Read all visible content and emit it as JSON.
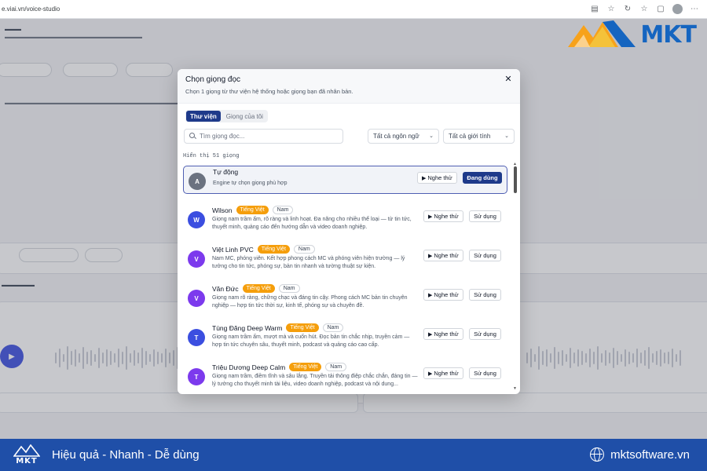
{
  "browser": {
    "url": "e.viai.vn/voice-studio"
  },
  "logo": {
    "text": "MKT"
  },
  "modal": {
    "title": "Chọn giọng đọc",
    "subtitle": "Chọn 1 giọng từ thư viện hệ thống hoặc giọng bạn đã nhân bản.",
    "tabs": [
      {
        "label": "Thư viện",
        "active": true
      },
      {
        "label": "Giọng của tôi",
        "active": false
      }
    ],
    "search_placeholder": "Tìm giọng đọc...",
    "language_filter": "Tất cả ngôn ngữ",
    "gender_filter": "Tất cả giới tính",
    "count_text": "Hiển thị 51 giọng",
    "voices": [
      {
        "initial": "A",
        "name": "Tự động",
        "desc": "Engine tự chọn giọng phù hợp",
        "listen": "Nghe thử",
        "action": "Đang dùng",
        "avatar_color": "#6b7280"
      },
      {
        "initial": "W",
        "name": "Wilson",
        "lang": "Tiếng Việt",
        "gender": "Nam",
        "desc": "Giọng nam trầm ấm, rõ ràng và linh hoạt. Đa năng cho nhiều thể loại — từ tin tức, thuyết minh, quảng cáo đến hướng dẫn và video doanh nghiệp.",
        "listen": "Nghe thử",
        "action": "Sử dụng",
        "avatar_color": "#3b4ee0"
      },
      {
        "initial": "V",
        "name": "Việt Linh PVC",
        "lang": "Tiếng Việt",
        "gender": "Nam",
        "desc": "Nam MC, phóng viên. Kết hợp phong cách MC và phóng viên hiện trường — lý tưởng cho tin tức, phóng sự, bản tin nhanh và tường thuật sự kiện.",
        "listen": "Nghe thử",
        "action": "Sử dụng",
        "avatar_color": "#7c3aed"
      },
      {
        "initial": "V",
        "name": "Văn Đức",
        "lang": "Tiếng Việt",
        "gender": "Nam",
        "desc": "Giọng nam rõ ràng, chững chạc và đáng tin cậy. Phong cách MC bản tin chuyên nghiệp — hợp tin tức thời sự, kinh tế, phóng sự và chuyên đề.",
        "listen": "Nghe thử",
        "action": "Sử dụng",
        "avatar_color": "#7c3aed"
      },
      {
        "initial": "T",
        "name": "Tùng Đăng Deep Warm",
        "lang": "Tiếng Việt",
        "gender": "Nam",
        "desc": "Giọng nam trầm ấm, mượt mà và cuốn hút. Đọc bản tin chắc nhịp, truyền cảm — hợp tin tức chuyên sâu, thuyết minh, podcast và quảng cáo cao cấp.",
        "listen": "Nghe thử",
        "action": "Sử dụng",
        "avatar_color": "#3b4ee0"
      },
      {
        "initial": "T",
        "name": "Triệu Dương Deep Calm",
        "lang": "Tiếng Việt",
        "gender": "Nam",
        "desc": "Giọng nam trầm, điềm tĩnh và sâu lắng. Truyền tải thông điệp chắc chắn, đáng tin — lý tưởng cho thuyết minh tài liệu, video doanh nghiệp, podcast và nội dung...",
        "listen": "Nghe thử",
        "action": "Sử dụng",
        "avatar_color": "#7c3aed"
      }
    ]
  },
  "footer": {
    "logo_text": "MKT",
    "tagline": "Hiệu quả - Nhanh - Dễ dùng",
    "website": "mktsoftware.vn"
  },
  "colors": {
    "primary": "#1e3a8a",
    "badge": "#f59e0b",
    "footer": "#1f4fa8"
  }
}
